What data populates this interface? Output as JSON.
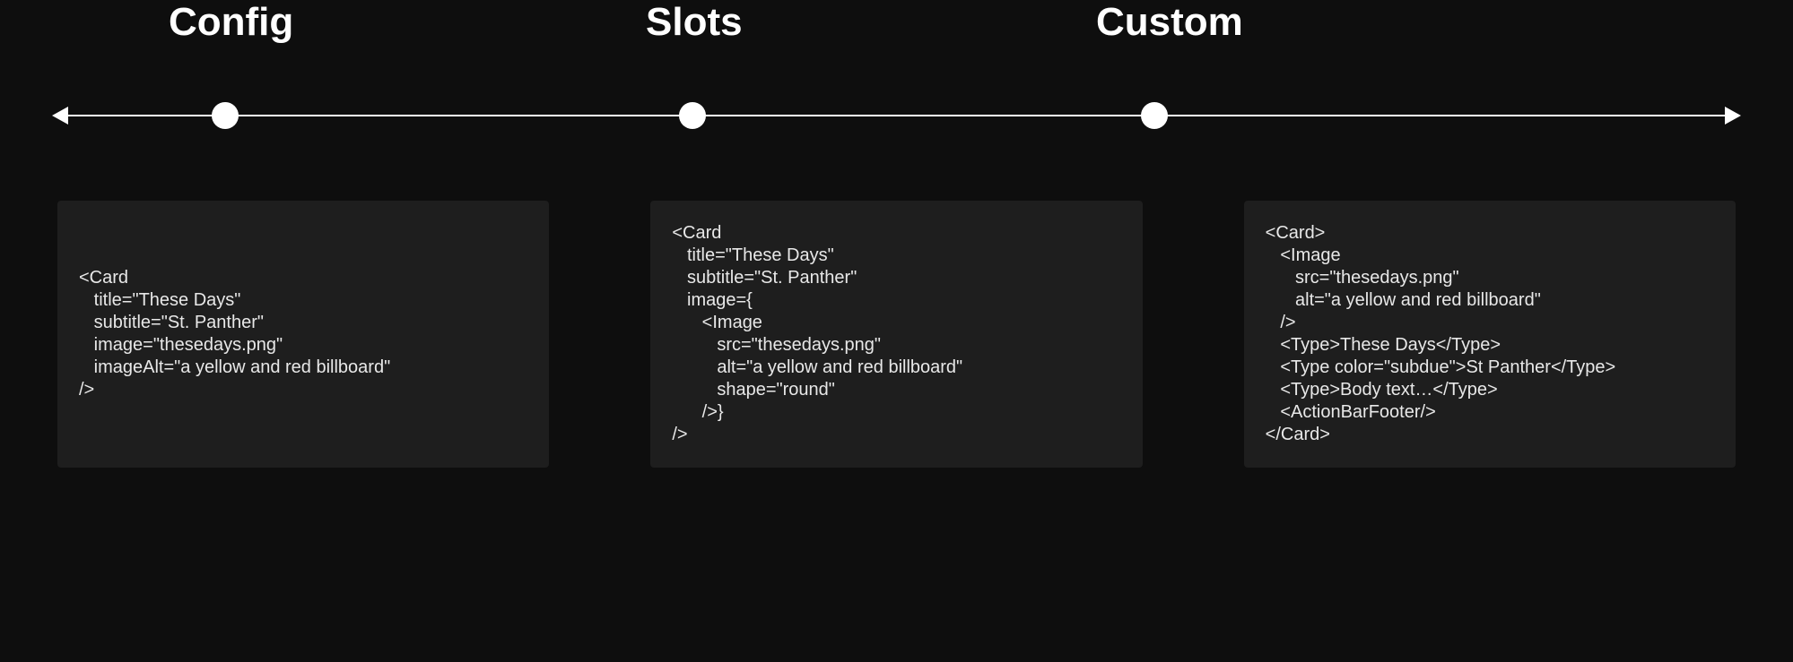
{
  "headings": {
    "config": "Config",
    "slots": "Slots",
    "custom": "Custom"
  },
  "code": {
    "config": "<Card\n   title=\"These Days\"\n   subtitle=\"St. Panther\"\n   image=\"thesedays.png\"\n   imageAlt=\"a yellow and red billboard\"\n/>",
    "slots": "<Card\n   title=\"These Days\"\n   subtitle=\"St. Panther\"\n   image={\n      <Image\n         src=\"thesedays.png\"\n         alt=\"a yellow and red billboard\"\n         shape=\"round\"\n      />}\n/>",
    "custom": "<Card>\n   <Image\n      src=\"thesedays.png\"\n      alt=\"a yellow and red billboard\"\n   />\n   <Type>These Days</Type>\n   <Type color=\"subdue\">St Panther</Type>\n   <Type>Body text…</Type>\n   <ActionBarFooter/>\n</Card>"
  }
}
